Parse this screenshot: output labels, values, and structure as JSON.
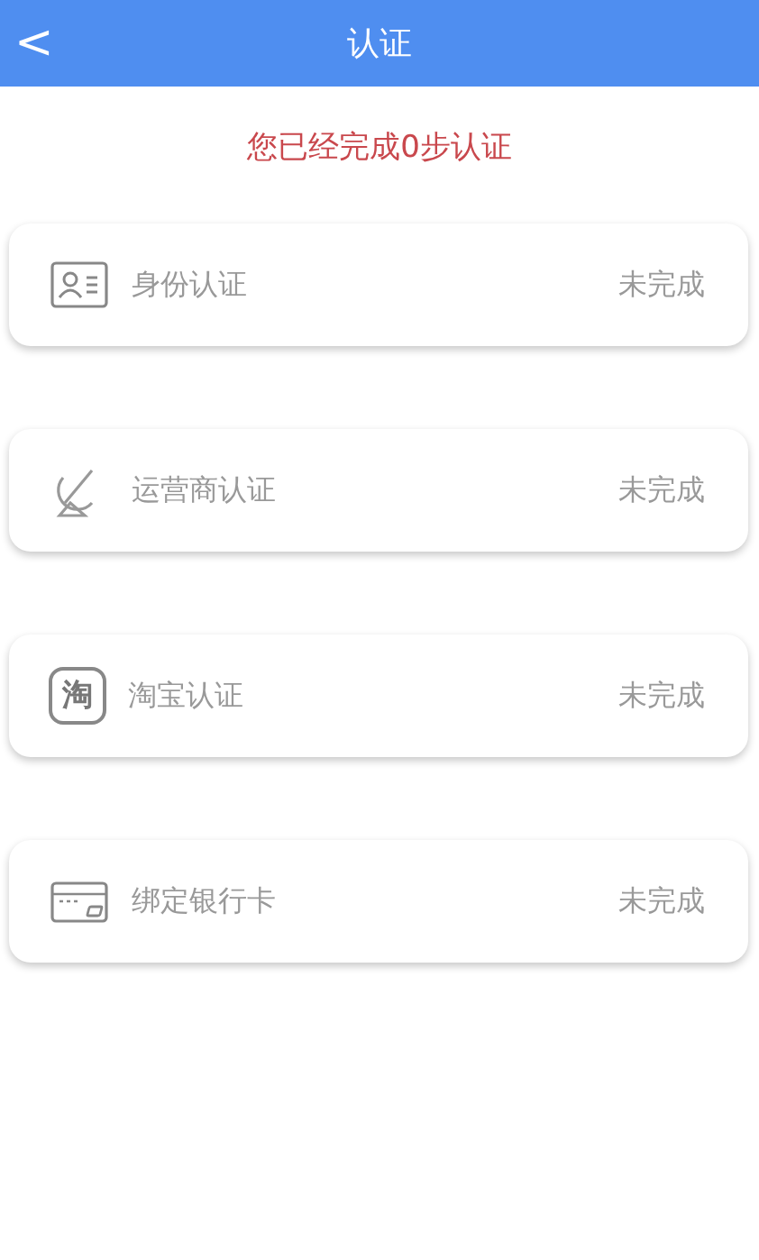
{
  "header": {
    "back_glyph": "<",
    "title": "认证"
  },
  "summary": "您已经完成0步认证",
  "items": [
    {
      "kind": "id",
      "label": "身份认证",
      "status": "未完成"
    },
    {
      "kind": "carrier",
      "label": "运营商认证",
      "status": "未完成"
    },
    {
      "kind": "taobao",
      "icon_glyph": "淘",
      "label": "淘宝认证",
      "status": "未完成"
    },
    {
      "kind": "bankcard",
      "label": "绑定银行卡",
      "status": "未完成"
    }
  ]
}
